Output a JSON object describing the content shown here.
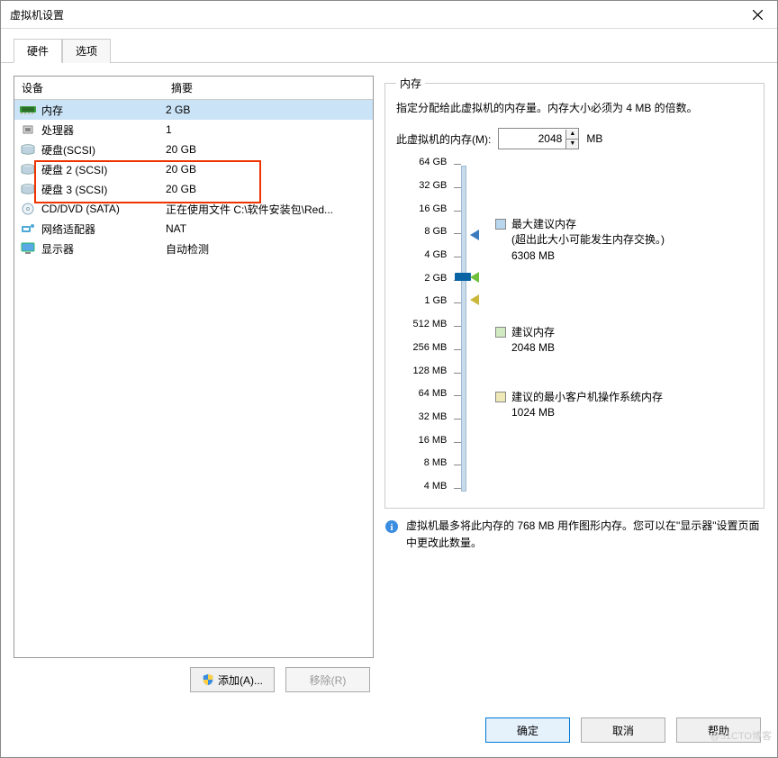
{
  "window": {
    "title": "虚拟机设置"
  },
  "tabs": {
    "hardware": "硬件",
    "options": "选项"
  },
  "device_header": {
    "device": "设备",
    "summary": "摘要"
  },
  "devices": [
    {
      "icon": "memory-icon",
      "name": "内存",
      "summary": "2 GB"
    },
    {
      "icon": "cpu-icon",
      "name": "处理器",
      "summary": "1"
    },
    {
      "icon": "disk-icon",
      "name": "硬盘(SCSI)",
      "summary": "20 GB"
    },
    {
      "icon": "disk-icon",
      "name": "硬盘 2 (SCSI)",
      "summary": "20 GB"
    },
    {
      "icon": "disk-icon",
      "name": "硬盘 3 (SCSI)",
      "summary": "20 GB"
    },
    {
      "icon": "cd-icon",
      "name": "CD/DVD (SATA)",
      "summary": "正在使用文件 C:\\软件安装包\\Red..."
    },
    {
      "icon": "net-icon",
      "name": "网络适配器",
      "summary": "NAT"
    },
    {
      "icon": "monitor-icon",
      "name": "显示器",
      "summary": "自动检测"
    }
  ],
  "buttons": {
    "add": "添加(A)...",
    "remove": "移除(R)",
    "ok": "确定",
    "cancel": "取消",
    "help": "帮助"
  },
  "memory_panel": {
    "legend": "内存",
    "desc": "指定分配给此虚拟机的内存量。内存大小必须为 4 MB 的倍数。",
    "field_label": "此虚拟机的内存(M):",
    "value": "2048",
    "unit": "MB",
    "ticks": [
      "64 GB",
      "32 GB",
      "16 GB",
      "8 GB",
      "4 GB",
      "2 GB",
      "1 GB",
      "512 MB",
      "256 MB",
      "128 MB",
      "64 MB",
      "32 MB",
      "16 MB",
      "8 MB",
      "4 MB"
    ],
    "legend_items": {
      "max": {
        "title": "最大建议内存",
        "sub1": "(超出此大小可能发生内存交换。)",
        "sub2": "6308 MB"
      },
      "rec": {
        "title": "建议内存",
        "sub1": "2048 MB"
      },
      "min": {
        "title": "建议的最小客户机操作系统内存",
        "sub1": "1024 MB"
      }
    },
    "hint": "虚拟机最多将此内存的 768 MB 用作图形内存。您可以在\"显示器\"设置页面中更改此数量。"
  },
  "watermark": "@51CTO博客"
}
